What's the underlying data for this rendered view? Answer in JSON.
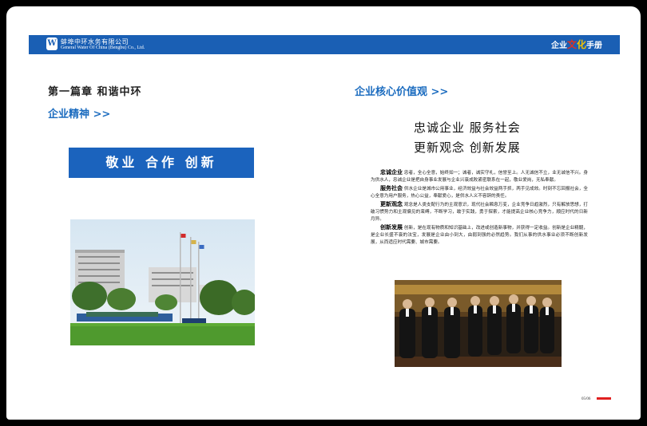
{
  "header": {
    "logo_mark": "W",
    "company_cn": "蚌埠中环水务有限公司",
    "company_en": "General Water Of China (Bengbu) Co., Ltd.",
    "manual_prefix": "企业",
    "manual_hl1": "文",
    "manual_hl2": "化",
    "manual_suffix": "手册"
  },
  "left": {
    "chapter": "第一篇章  和谐中环",
    "section": "企业精神 >>",
    "motto": "敬业 合作 创新"
  },
  "right": {
    "section": "企业核心价值观 >>",
    "slogan_line1": "忠诚企业  服务社会",
    "slogan_line2": "更新观念  创新发展",
    "values": [
      {
        "term": "忠诚企业",
        "text": "忠者，全心全意，始终如一；诚者，诚实守礼，信誉至上。人无诚信不立，业无诚信不兴。身为供水人，忠诚企业是把自身事业发展与企业兴衰成败紧密联系在一起，敬业爱岗，无私奉献。"
      },
      {
        "term": "服务社会",
        "text": "供水企业是城市公用事业，经济效益与社会效益两手抓，两手见成效。时刻不忘回报社会，全心全意为用户服务，热心公益，奉献爱心，是供水人义不容辞的责任。"
      },
      {
        "term": "更新观念",
        "text": "观念是人类支配行为的主观意识，现代社会瞬息万变，企业竞争日趋激烈，只有解放思想，打破习惯势力和主观偏见的束缚，不断学习，敢于实践，勇于探索，才能提高企业核心竞争力，顺应时代的日新月异。"
      },
      {
        "term": "创新发展",
        "text": "创新，是在现有物质和知识基础上，改进或创造新事物，并获得一定收益。创新是企业精髓，是企业长盛不衰的法宝，发展是企业由小到大，由弱到强的必然趋势。我们从事的供水事业必须不断创新发展，从而适应时代需要、城市需要。"
      }
    ]
  },
  "footer": {
    "page_number": "05/06"
  },
  "colors": {
    "brand_blue": "#1a5fb4",
    "accent_red": "#e02020"
  }
}
